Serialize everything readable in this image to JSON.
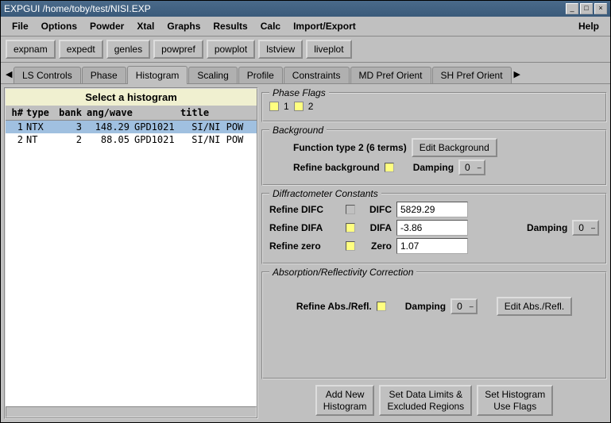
{
  "title": "EXPGUI /home/toby/test/NISI.EXP",
  "menu": [
    "File",
    "Options",
    "Powder",
    "Xtal",
    "Graphs",
    "Results",
    "Calc",
    "Import/Export"
  ],
  "menu_right": "Help",
  "toolbar": [
    "expnam",
    "expedt",
    "genles",
    "powpref",
    "powplot",
    "lstview",
    "liveplot"
  ],
  "tabs": [
    "LS Controls",
    "Phase",
    "Histogram",
    "Scaling",
    "Profile",
    "Constraints",
    "MD Pref Orient",
    "SH Pref Orient"
  ],
  "active_tab": 2,
  "histogram": {
    "header": "Select a histogram",
    "cols": {
      "h": "h#",
      "type": "type",
      "bank": "bank",
      "ang": "ang/wave",
      "title": "title"
    },
    "rows": [
      {
        "h": "1",
        "type": "NTX",
        "bank": "3",
        "ang": "148.29",
        "title": "GPD1021   SI/NI POW"
      },
      {
        "h": "2",
        "type": "NT",
        "bank": "2",
        "ang": "88.05",
        "title": "GPD1021   SI/NI POW"
      }
    ],
    "selected": 0
  },
  "phase": {
    "title": "Phase Flags",
    "labels": [
      "1",
      "2"
    ]
  },
  "background": {
    "title": "Background",
    "func": "Function type 2  (6 terms)",
    "edit": "Edit Background",
    "refine": "Refine background",
    "damping": "Damping",
    "damp_val": "0"
  },
  "diffract": {
    "title": "Diffractometer Constants",
    "difc_l": "Refine DIFC",
    "difc_n": "DIFC",
    "difc_v": "5829.29",
    "difa_l": "Refine DIFA",
    "difa_n": "DIFA",
    "difa_v": "-3.86",
    "zero_l": "Refine zero",
    "zero_n": "Zero",
    "zero_v": "1.07",
    "damping": "Damping",
    "damp_val": "0"
  },
  "absorp": {
    "title": "Absorption/Reflectivity Correction",
    "refine": "Refine Abs./Refl.",
    "damping": "Damping",
    "damp_val": "0",
    "edit": "Edit Abs./Refl."
  },
  "bottom": {
    "add": "Add New\nHistogram",
    "limits": "Set Data Limits &\nExcluded Regions",
    "flags": "Set Histogram\nUse Flags"
  }
}
